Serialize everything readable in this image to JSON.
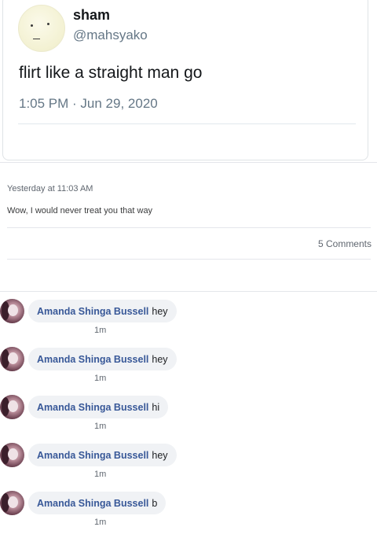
{
  "tweet": {
    "display_name": "sham",
    "handle": "@mahsyako",
    "text": "flirt like a straight man go",
    "meta": "1:05 PM · Jun 29, 2020"
  },
  "post": {
    "timestamp": "Yesterday at 11:03 AM",
    "text": "Wow, I would never treat you that way",
    "comments_count": "5 Comments"
  },
  "comments": [
    {
      "author": "Amanda Shinga Bussell",
      "text": "hey",
      "time": "1m"
    },
    {
      "author": "Amanda Shinga Bussell",
      "text": "hey",
      "time": "1m"
    },
    {
      "author": "Amanda Shinga Bussell",
      "text": "hi",
      "time": "1m"
    },
    {
      "author": "Amanda Shinga Bussell",
      "text": "hey",
      "time": "1m"
    },
    {
      "author": "Amanda Shinga Bussell",
      "text": "b",
      "time": "1m"
    }
  ],
  "icons": {
    "tweet_avatar": "yellow-face-avatar",
    "comment_avatar": "profile-photo-avatar"
  },
  "colors": {
    "author_link": "#385898",
    "bubble_bg": "#f0f2f5",
    "secondary_text": "#657786"
  }
}
